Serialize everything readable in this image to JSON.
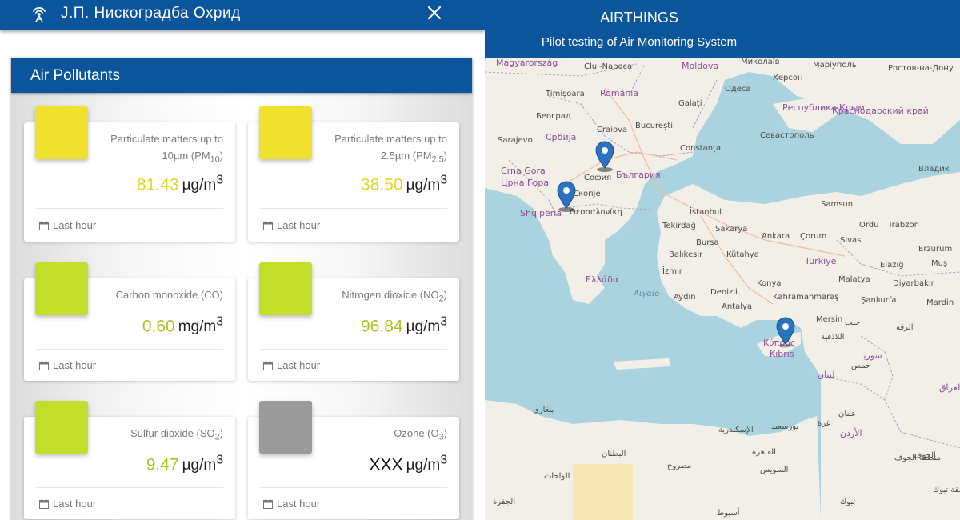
{
  "header": {
    "station_name": "Ј.П. Нискоградба Охрид",
    "close_label": "×"
  },
  "pollutants_card": {
    "title": "Air Pollutants",
    "tiles": [
      {
        "label_html": "Particulate matters up to 10µm (PM<sub>10</sub>)",
        "value": "81.43",
        "unit_html": "µg/m<sup>3</sup>",
        "color": "#efe12d",
        "value_color": "#e3d52b",
        "footer": "Last hour"
      },
      {
        "label_html": "Particulate matters up to 2.5µm (PM<sub>2.5</sub>)",
        "value": "38.50",
        "unit_html": "µg/m<sup>3</sup>",
        "color": "#efe12d",
        "value_color": "#e3d52b",
        "footer": "Last hour"
      },
      {
        "label_html": "Carbon monoxide (CO)",
        "value": "0.60",
        "unit_html": "mg/m<sup>3</sup>",
        "color": "#c3de28",
        "value_color": "#a9c41f",
        "footer": "Last hour"
      },
      {
        "label_html": "Nitrogen dioxide (NO<sub>2</sub>)",
        "value": "96.84",
        "unit_html": "µg/m<sup>3</sup>",
        "color": "#c3de28",
        "value_color": "#a9c41f",
        "footer": "Last hour"
      },
      {
        "label_html": "Sulfur dioxide (SO<sub>2</sub>)",
        "value": "9.47",
        "unit_html": "µg/m<sup>3</sup>",
        "color": "#c3de28",
        "value_color": "#a9c41f",
        "footer": "Last hour"
      },
      {
        "label_html": "Ozone (O<sub>3</sub>)",
        "value": "XXX",
        "unit_html": "µg/m<sup>3</sup>",
        "color": "#9b9b9b",
        "value_color": "#111111",
        "footer": "Last hour"
      }
    ]
  },
  "map_header": {
    "title": "AIRTHINGS",
    "subtitle": "Pilot testing of Air Monitoring System"
  },
  "map": {
    "countries": [
      "Magyarország",
      "România",
      "Moldova",
      "Србија",
      "България",
      "Crna Gora",
      "Црна Гора",
      "Shqipëria",
      "Ελλάδα",
      "Türkiye",
      "Κύπρος",
      "Kıbrıs",
      "Республика Крым",
      "Краснодарский край",
      "سوريا",
      "لبنان",
      "العراق",
      "الأردن"
    ],
    "seas": [
      "Αιγαίο"
    ],
    "cities": [
      "Cluj-Napoca",
      "Миколаїв",
      "Маріуполь",
      "Ростов-на-Дону",
      "Херсон",
      "Одеса",
      "Timișoara",
      "Galați",
      "Београд",
      "Craiova",
      "București",
      "Sarajevo",
      "Constanța",
      "Севастополь",
      "София",
      "Скопје",
      "Θεσσαλονίκη",
      "İstanbul",
      "Samsun",
      "Ordu",
      "Trabzon",
      "Tekirdağ",
      "Sakarya",
      "Bursa",
      "Ankara",
      "Çorum",
      "Sivas",
      "Erzurum",
      "Balıkesir",
      "Kütahya",
      "Elazığ",
      "Muş",
      "İzmir",
      "Konya",
      "Malatya",
      "Diyarbakır",
      "Aydın",
      "Denizli",
      "Kahramanmaraş",
      "Şanlıurfa",
      "Mardin",
      "Antalya",
      "Mersin",
      "حلب",
      "الرقة",
      "اللاذقية",
      "حمص",
      "بنغازي",
      "عمان",
      "غزة",
      "الإسكندرية",
      "بورسعيد",
      "القاهرة",
      "السويس",
      "مطروح",
      "البطنان",
      "الواحات",
      "أسيوط",
      "تبوك",
      "الجوف",
      "منطقة الجوف",
      "منطقة تبوك",
      "الجفرة",
      "Владик"
    ],
    "markers": [
      "ohrid-marker",
      "sofia-marker",
      "cyprus-marker"
    ]
  }
}
